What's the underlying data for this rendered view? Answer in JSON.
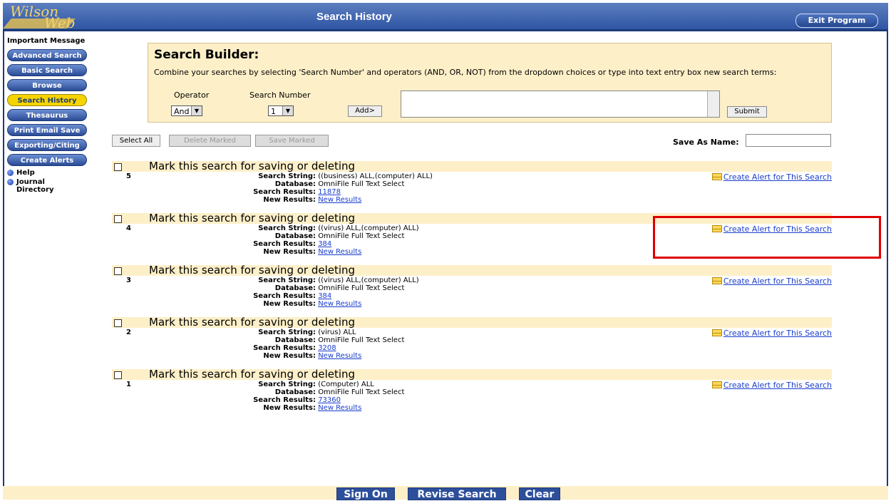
{
  "header": {
    "logo_line1": "Wilson",
    "logo_line2": "Web",
    "title": "Search History",
    "exit_label": "Exit Program"
  },
  "sidebar": {
    "important_message": "Important Message",
    "buttons": [
      "Advanced Search",
      "Basic Search",
      "Browse",
      "Search History",
      "Thesaurus",
      "Print Email Save",
      "Exporting/Citing",
      "Create Alerts"
    ],
    "active": "Search History",
    "links": [
      "Help",
      "Journal Directory"
    ]
  },
  "builder": {
    "title": "Search Builder:",
    "description": "Combine your searches by selecting 'Search Number' and operators (AND, OR, NOT) from the dropdown choices or type into text entry box new search terms:",
    "operator_label": "Operator",
    "operator_value": "And",
    "number_label": "Search Number",
    "number_value": "1",
    "add_label": "Add>",
    "submit_label": "Submit"
  },
  "actions": {
    "select_all": "Select All",
    "delete_marked": "Delete Marked",
    "save_marked": "Save Marked",
    "save_as_name": "Save As Name:"
  },
  "labels": {
    "mark": "Mark this search for saving or deleting",
    "search_string": "Search String:",
    "database": "Database:",
    "search_results": "Search Results:",
    "new_results": "New Results:",
    "new_results_link": "New Results",
    "create_alert": "Create Alert for This Search"
  },
  "entries": [
    {
      "number": "5",
      "search_string": "((business) ALL,(computer) ALL)",
      "database": "OmniFile Full Text Select",
      "results": "11878"
    },
    {
      "number": "4",
      "search_string": "((virus) ALL,(computer) ALL)",
      "database": "OmniFile Full Text Select",
      "results": "384"
    },
    {
      "number": "3",
      "search_string": "((virus) ALL,(computer) ALL)",
      "database": "OmniFile Full Text Select",
      "results": "384"
    },
    {
      "number": "2",
      "search_string": "(virus) ALL",
      "database": "OmniFile Full Text Select",
      "results": "3208"
    },
    {
      "number": "1",
      "search_string": "(Computer) ALL",
      "database": "OmniFile Full Text Select",
      "results": "73360"
    }
  ],
  "footer": {
    "sign_on": "Sign On",
    "revise_search": "Revise Search",
    "clear": "Clear"
  },
  "colors": {
    "header": "#2f55a4",
    "band": "#fdefc8",
    "highlight_box": "#e00000",
    "active_button": "#f5d400",
    "link": "#1a3ecc"
  }
}
